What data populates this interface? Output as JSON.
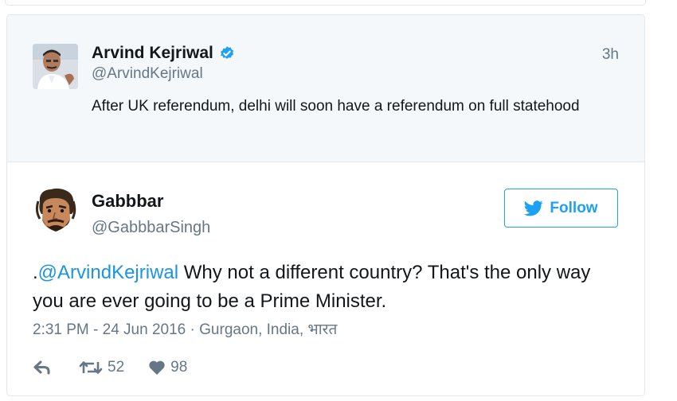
{
  "quoted_tweet": {
    "author_name": "Arvind Kejriwal",
    "author_handle": "@ArvindKejriwal",
    "time_ago": "3h",
    "text": "After UK referendum, delhi will soon have a referendum on full statehood"
  },
  "tweet": {
    "author_name": "Gabbbar",
    "author_handle": "@GabbbarSingh",
    "follow_label": "Follow",
    "text_prefix": ".",
    "mention": "@ArvindKejriwal",
    "text_rest": " Why not a different country? That's the only way you are ever going to be a Prime Minister.",
    "timestamp": "2:31 PM - 24 Jun 2016",
    "separator": " · ",
    "location": "Gurgaon, India, भारत",
    "retweet_count": "52",
    "like_count": "98"
  },
  "colors": {
    "twitter_blue": "#1da1f2",
    "link_blue": "#1b95e0",
    "secondary_text": "#657786",
    "quoted_bg": "#f5f8fa"
  },
  "icons": [
    "verified-badge-icon",
    "twitter-bird-icon",
    "reply-icon",
    "retweet-icon",
    "heart-icon"
  ]
}
